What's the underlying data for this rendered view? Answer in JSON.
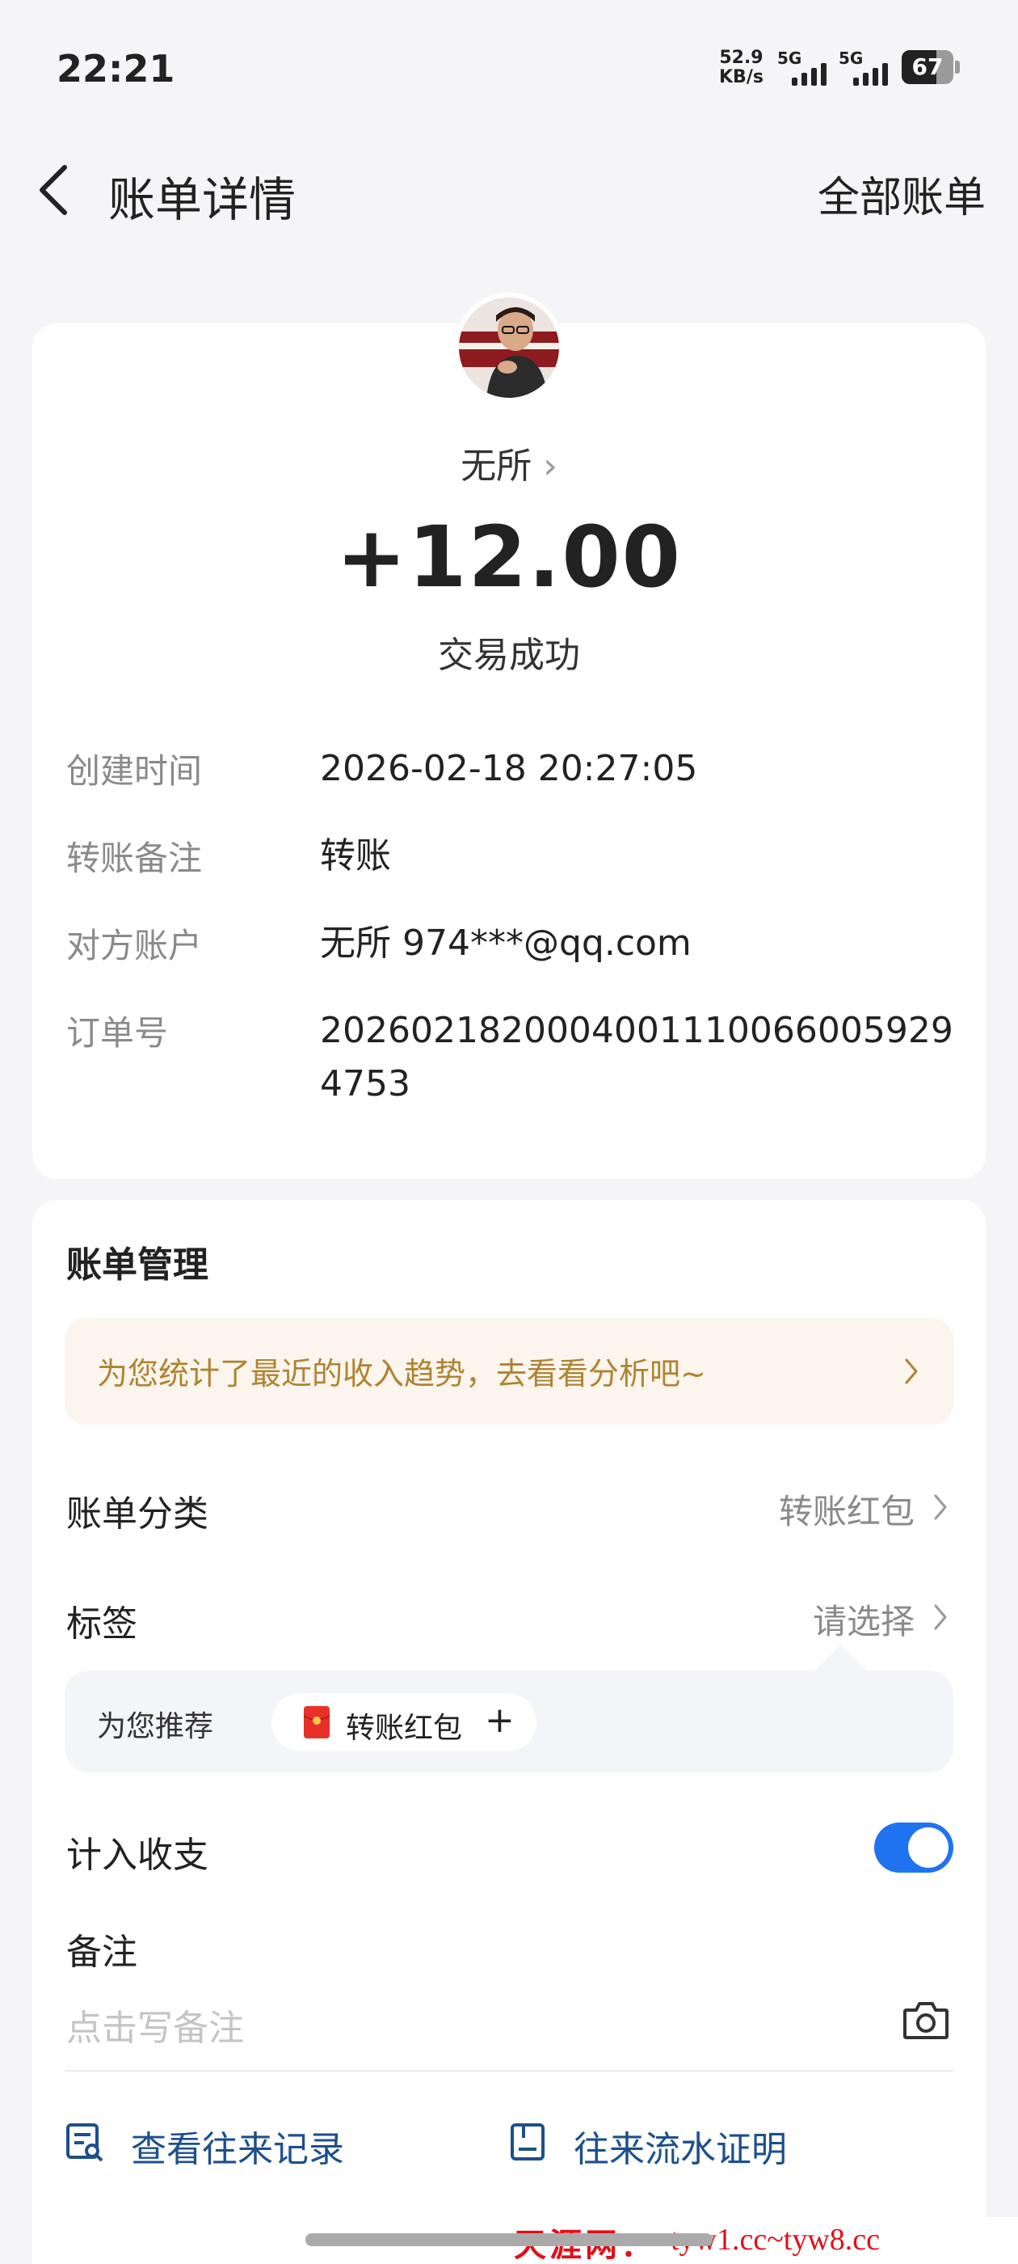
{
  "status_bar": {
    "time": "22:21",
    "net_speed_value": "52.9",
    "net_speed_unit": "KB/s",
    "signal1_label": "5G",
    "signal2_label": "5G",
    "battery": "67"
  },
  "nav": {
    "title": "账单详情",
    "right_link": "全部账单"
  },
  "transaction": {
    "counterparty": "无所",
    "amount": "+12.00",
    "status": "交易成功"
  },
  "details": [
    {
      "label": "创建时间",
      "value": "2026-02-18 20:27:05"
    },
    {
      "label": "转账备注",
      "value": "转账"
    },
    {
      "label": "对方账户",
      "value": "无所 974***@qq.com"
    },
    {
      "label": "订单号",
      "value": "20260218200040011100660059294753"
    }
  ],
  "management": {
    "title": "账单管理",
    "banner_text": "为您统计了最近的收入趋势，去看看分析吧~",
    "category_label": "账单分类",
    "category_value": "转账红包",
    "tag_label": "标签",
    "tag_value": "请选择",
    "recommend_label": "为您推荐",
    "recommend_chip": "转账红包",
    "recommend_chip_plus": "+",
    "include_label": "计入收支",
    "include_enabled": true,
    "note_label": "备注",
    "note_placeholder": "点击写备注"
  },
  "links": {
    "history": "查看往来记录",
    "statement": "往来流水证明"
  },
  "watermark": {
    "cn": "天涯网：",
    "url": "tyw1.cc~tyw8.cc"
  },
  "colors": {
    "accent_blue": "#1f73f0",
    "link_blue": "#1e4f8c",
    "banner_gold": "#b08330",
    "watermark_red": "#e0101a"
  }
}
